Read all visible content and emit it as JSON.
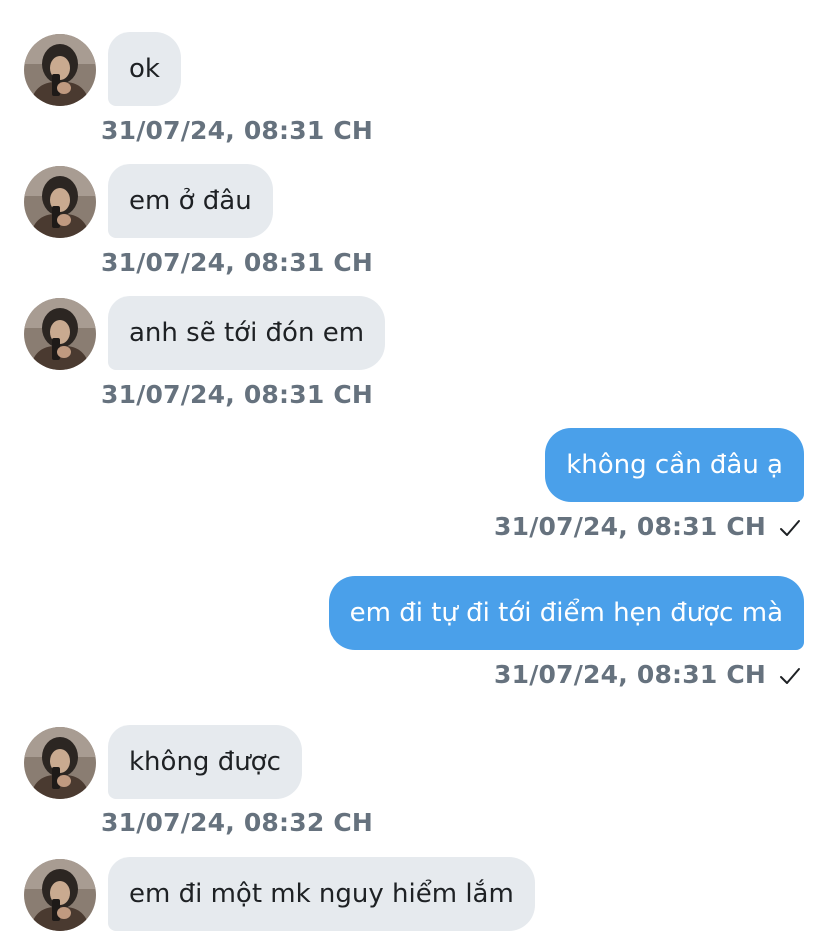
{
  "messages": [
    {
      "direction": "in",
      "text": "ok",
      "timestamp": "31/07/24, 08:31 CH"
    },
    {
      "direction": "in",
      "text": "em ở đâu",
      "timestamp": "31/07/24, 08:31 CH"
    },
    {
      "direction": "in",
      "text": "anh sẽ tới đón em",
      "timestamp": "31/07/24, 08:31 CH"
    },
    {
      "direction": "out",
      "text": "không cần đâu ạ",
      "timestamp": "31/07/24, 08:31 CH",
      "status_icon": "check-icon"
    },
    {
      "direction": "out",
      "text": "em đi tự đi tới điểm hẹn được mà",
      "timestamp": "31/07/24, 08:31 CH",
      "status_icon": "check-icon"
    },
    {
      "direction": "in",
      "text": "không được",
      "timestamp": "31/07/24, 08:32 CH"
    },
    {
      "direction": "in",
      "text": "em đi một mk nguy hiểm lắm",
      "timestamp": ""
    }
  ],
  "colors": {
    "incoming_bubble": "#e6eaee",
    "outgoing_bubble": "#4aa0ea",
    "timestamp": "#66727e",
    "background": "#ffffff"
  }
}
